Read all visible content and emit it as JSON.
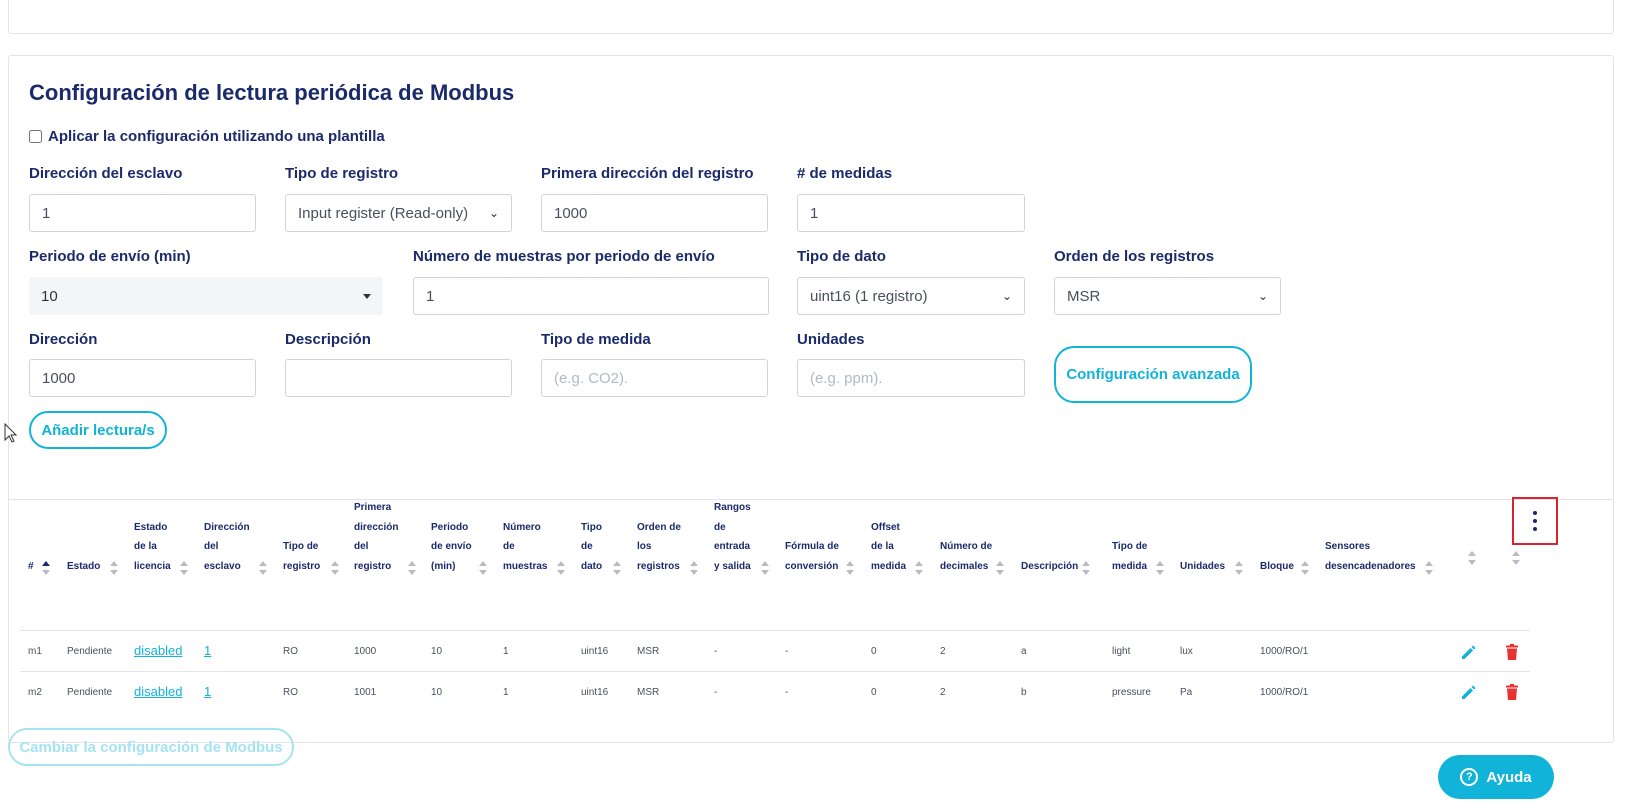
{
  "form": {
    "title": "Configuración de lectura periódica de Modbus",
    "template_label": "Aplicar la configuración utilizando una plantilla",
    "slave_address": {
      "label": "Dirección del esclavo",
      "value": "1"
    },
    "register_type": {
      "label": "Tipo de registro",
      "value": "Input register (Read-only)"
    },
    "first_register": {
      "label": "Primera dirección del registro",
      "value": "1000"
    },
    "num_measures": {
      "label": "# de medidas",
      "value": "1"
    },
    "send_period": {
      "label": "Periodo de envío (min)",
      "value": "10"
    },
    "samples": {
      "label": "Número de muestras por periodo de envío",
      "value": "1"
    },
    "data_type": {
      "label": "Tipo de dato",
      "value": "uint16 (1 registro)"
    },
    "register_order": {
      "label": "Orden de los registros",
      "value": "MSR"
    },
    "address": {
      "label": "Dirección",
      "value": "1000"
    },
    "description": {
      "label": "Descripción",
      "value": ""
    },
    "measure_type": {
      "label": "Tipo de medida",
      "placeholder": "(e.g. CO2)."
    },
    "units": {
      "label": "Unidades",
      "placeholder": "(e.g. ppm)."
    },
    "advanced_button": "Configuración avanzada",
    "add_button": "Añadir lectura/s"
  },
  "table": {
    "headers": {
      "num": "#",
      "estado": "Estado",
      "licencia": [
        "Estado",
        "de la",
        "licencia"
      ],
      "esclavo": [
        "Dirección",
        "del",
        "esclavo"
      ],
      "tipo_registro": [
        "Tipo de",
        "registro"
      ],
      "primera": [
        "Primera",
        "dirección",
        "del",
        "registro"
      ],
      "periodo": [
        "Periodo",
        "de envío",
        "(min)"
      ],
      "muestras": [
        "Número",
        "de",
        "muestras"
      ],
      "tipo_dato": [
        "Tipo",
        "de",
        "dato"
      ],
      "orden": [
        "Orden de",
        "los",
        "registros"
      ],
      "rangos": [
        "Rangos",
        "de",
        "entrada",
        "y salida"
      ],
      "formula": [
        "Fórmula de",
        "conversión"
      ],
      "offset": [
        "Offset",
        "de la",
        "medida"
      ],
      "decimales": [
        "Número de",
        "decimales"
      ],
      "descripcion": "Descripción",
      "tipo_medida": [
        "Tipo de",
        "medida"
      ],
      "unidades": "Unidades",
      "bloque": "Bloque",
      "sensores": [
        "Sensores",
        "desencadenadores"
      ]
    },
    "rows": [
      {
        "num": "m1",
        "estado": "Pendiente",
        "licencia": "disabled",
        "esclavo": "1",
        "tipo_registro": "RO",
        "primera": "1000",
        "periodo": "10",
        "muestras": "1",
        "tipo_dato": "uint16",
        "orden": "MSR",
        "rangos": "-",
        "formula": "-",
        "offset": "0",
        "decimales": "2",
        "descripcion": "a",
        "tipo_medida": "light",
        "unidades": "lux",
        "bloque": "1000/RO/1"
      },
      {
        "num": "m2",
        "estado": "Pendiente",
        "licencia": "disabled",
        "esclavo": "1",
        "tipo_registro": "RO",
        "primera": "1001",
        "periodo": "10",
        "muestras": "1",
        "tipo_dato": "uint16",
        "orden": "MSR",
        "rangos": "-",
        "formula": "-",
        "offset": "0",
        "decimales": "2",
        "descripcion": "b",
        "tipo_medida": "pressure",
        "unidades": "Pa",
        "bloque": "1000/RO/1"
      }
    ]
  },
  "footer": {
    "change_button": "Cambiar la configuración de Modbus",
    "help_button": "Ayuda"
  },
  "colors": {
    "accent": "#12b3d8",
    "title": "#1b2a6b",
    "danger": "#e8322f"
  }
}
